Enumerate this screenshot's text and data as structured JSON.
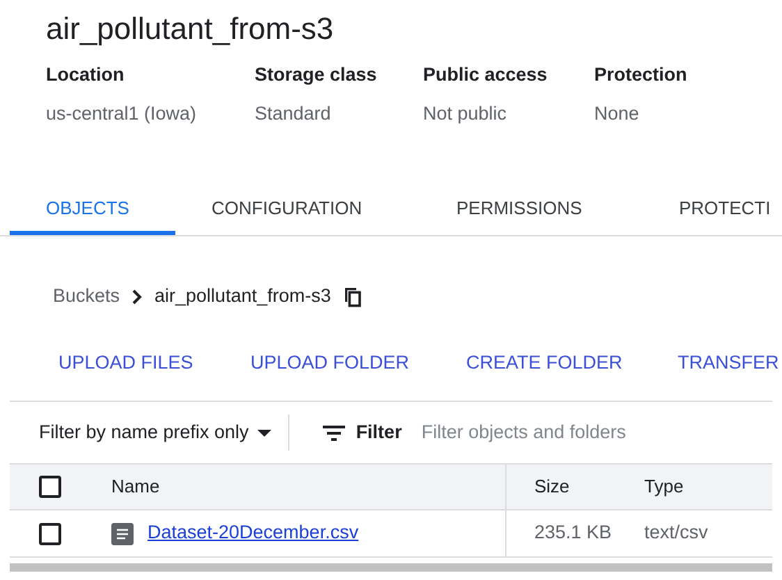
{
  "title": "air_pollutant_from-s3",
  "properties": [
    {
      "label": "Location",
      "value": "us-central1 (Iowa)"
    },
    {
      "label": "Storage class",
      "value": "Standard"
    },
    {
      "label": "Public access",
      "value": "Not public"
    },
    {
      "label": "Protection",
      "value": "None"
    }
  ],
  "tabs": [
    {
      "label": "OBJECTS",
      "selected": true
    },
    {
      "label": "CONFIGURATION",
      "selected": false
    },
    {
      "label": "PERMISSIONS",
      "selected": false
    },
    {
      "label": "PROTECTI",
      "selected": false
    }
  ],
  "breadcrumb": {
    "root": "Buckets",
    "current": "air_pollutant_from-s3"
  },
  "actions": [
    "UPLOAD FILES",
    "UPLOAD FOLDER",
    "CREATE FOLDER",
    "TRANSFER"
  ],
  "filter": {
    "mode": "Filter by name prefix only",
    "label": "Filter",
    "placeholder": "Filter objects and folders"
  },
  "table": {
    "select_all_checked": false,
    "columns": [
      "Name",
      "Size",
      "Type"
    ],
    "rows": [
      {
        "checked": false,
        "name": "Dataset-20December.csv",
        "size": "235.1 KB",
        "type": "text/csv"
      }
    ]
  }
}
